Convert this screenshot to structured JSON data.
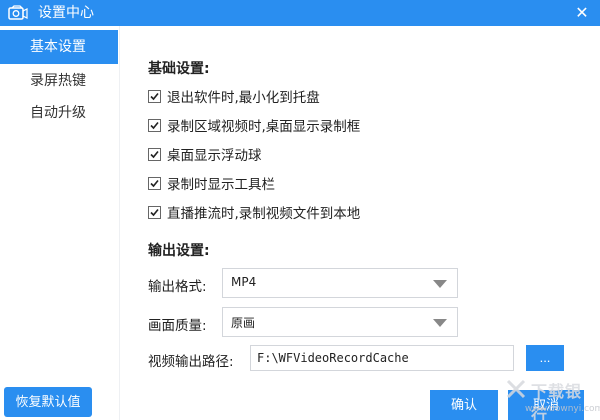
{
  "window": {
    "title": "设置中心",
    "close_glyph": "✕",
    "accent": "#2a8ef0"
  },
  "sidebar": {
    "items": [
      {
        "label": "基本设置",
        "active": true
      },
      {
        "label": "录屏热键",
        "active": false
      },
      {
        "label": "自动升级",
        "active": false
      }
    ]
  },
  "basic": {
    "title": "基础设置:",
    "options": [
      {
        "label": "退出软件时,最小化到托盘",
        "checked": true
      },
      {
        "label": "录制区域视频时,桌面显示录制框",
        "checked": true
      },
      {
        "label": "桌面显示浮动球",
        "checked": true
      },
      {
        "label": "录制时显示工具栏",
        "checked": true
      },
      {
        "label": "直播推流时,录制视频文件到本地",
        "checked": true
      }
    ]
  },
  "output": {
    "title": "输出设置:",
    "format_label": "输出格式:",
    "format_value": "MP4",
    "quality_label": "画面质量:",
    "quality_value": "原画",
    "path_label": "视频输出路径:",
    "path_value": "F:\\WFVideoRecordCache",
    "browse_label": "..."
  },
  "footer": {
    "restore_label": "恢复默认值",
    "confirm_label": "确认",
    "cancel_label": "取消"
  },
  "watermark": {
    "text": "下载银行",
    "url": "www.downyi.com"
  }
}
